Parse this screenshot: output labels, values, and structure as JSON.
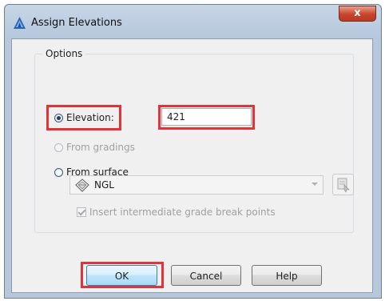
{
  "window": {
    "title": "Assign Elevations",
    "close_glyph": "x"
  },
  "options_group": {
    "label": "Options",
    "elevation": {
      "label": "Elevation:",
      "selected": true,
      "value": "421"
    },
    "from_gradings": {
      "label": "From gradings",
      "enabled": false
    },
    "from_surface": {
      "label": "From surface",
      "selected": false
    },
    "surface_select": {
      "value": "NGL",
      "icon": "surface-icon",
      "enabled": false
    },
    "pick_surface_icon": "pick-from-drawing-icon",
    "insert_breakpoints": {
      "label": "Insert intermediate grade break points",
      "checked": true,
      "enabled": false
    }
  },
  "buttons": {
    "ok": "OK",
    "cancel": "Cancel",
    "help": "Help"
  },
  "colors": {
    "highlight": "#e2333a",
    "title_bar": "#b7c8dd",
    "close_button": "#c8442c",
    "client_background": "#f0f0f0"
  }
}
